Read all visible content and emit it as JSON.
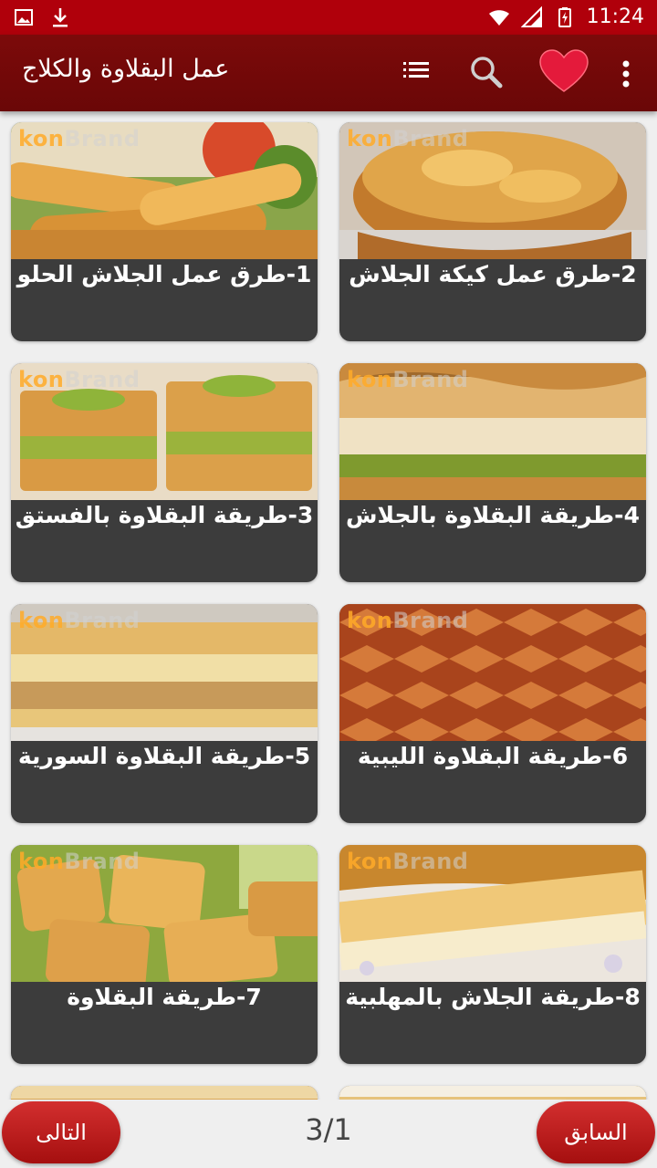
{
  "status_bar": {
    "time": "11:24"
  },
  "app_bar": {
    "title": "عمل البقلاوة والكلاج"
  },
  "watermark": {
    "kon": "kon",
    "brand": "Brand"
  },
  "cards": [
    {
      "label": "1-طرق عمل الجلاش الحلو"
    },
    {
      "label": "2-طرق عمل كيكة الجلاش"
    },
    {
      "label": "3-طريقة البقلاوة بالفستق"
    },
    {
      "label": "4-طريقة البقلاوة بالجلاش"
    },
    {
      "label": "5-طريقة البقلاوة السورية"
    },
    {
      "label": "6-طريقة البقلاوة الليبية"
    },
    {
      "label": "7-طريقة البقلاوة"
    },
    {
      "label": "8-طريقة الجلاش بالمهلبية"
    }
  ],
  "pagination": {
    "next_label": "التالى",
    "prev_label": "السابق",
    "page_indicator": "3/1"
  },
  "colors": {
    "status_bar": "#b0000b",
    "app_bar": "#720808",
    "card_bg": "#3c3c3c",
    "button": "#c62828"
  }
}
